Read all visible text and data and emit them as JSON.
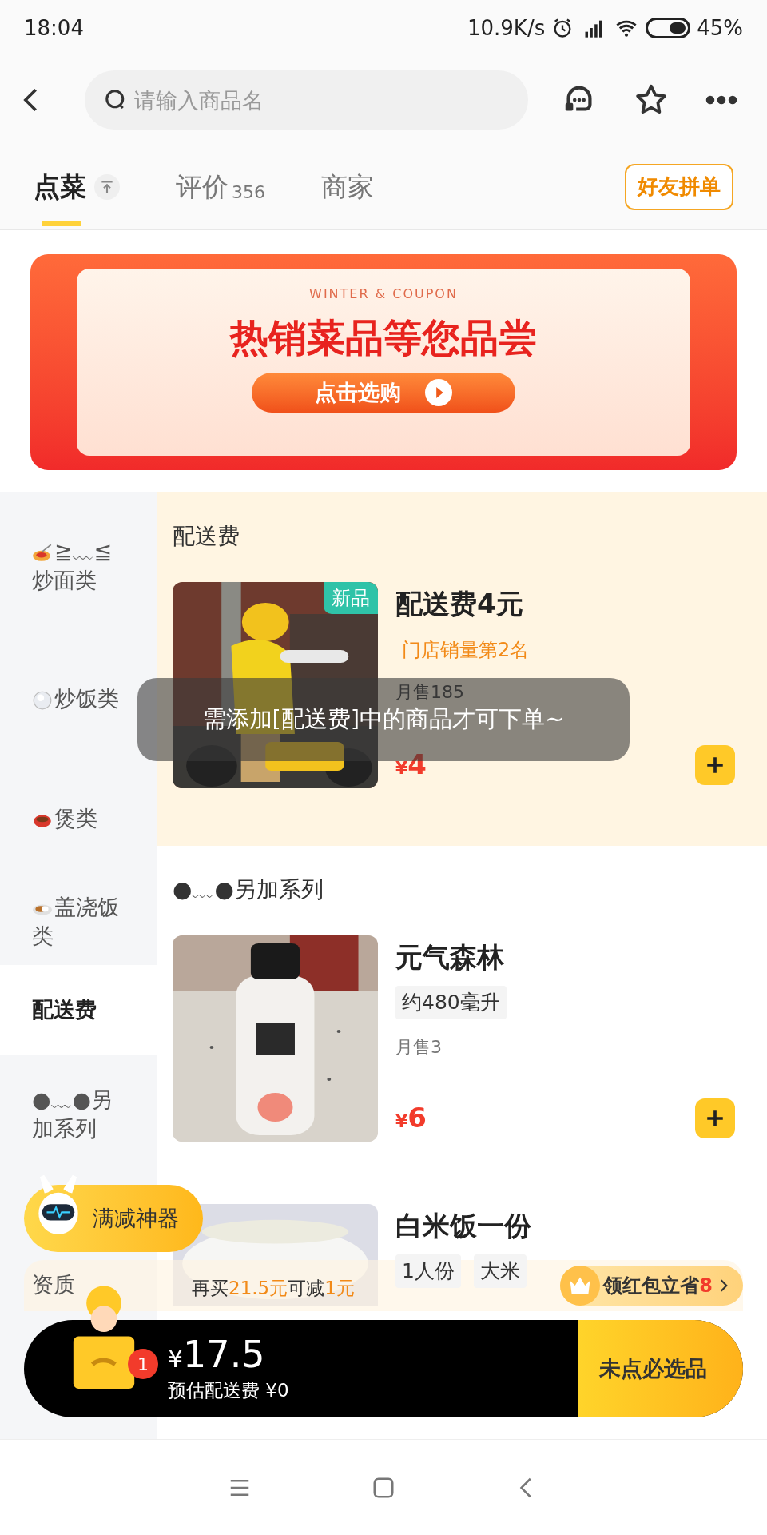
{
  "status_bar": {
    "time": "18:04",
    "net_speed": "10.9K/s",
    "battery": "45%"
  },
  "search": {
    "placeholder": "请输入商品名"
  },
  "tabs": [
    {
      "label": "点菜",
      "selected": true
    },
    {
      "label": "评价",
      "count": "356",
      "selected": false
    },
    {
      "label": "商家",
      "selected": false
    }
  ],
  "group_order_button": "好友拼单",
  "banner": {
    "subtitle": "WINTER & COUPON",
    "title": "热销菜品等您品尝",
    "button": "点击选购"
  },
  "sidebar": {
    "items": [
      {
        "kind": "noodles",
        "label": "≧﹏≦炒面类",
        "selected": false
      },
      {
        "kind": "rice",
        "label": "炒饭类",
        "selected": false
      },
      {
        "kind": "pot",
        "label": "煲类",
        "selected": false
      },
      {
        "kind": "curry",
        "label": "盖浇饭类",
        "selected": false
      },
      {
        "kind": "plain",
        "label": "配送费",
        "selected": true
      },
      {
        "kind": "plain",
        "label": "●﹏●另加系列",
        "selected": false
      },
      {
        "kind": "plain",
        "label": "资质",
        "selected": false
      }
    ]
  },
  "sections": [
    {
      "title": "配送费",
      "highlighted": true,
      "items": [
        {
          "name": "配送费4元",
          "badge": "新品",
          "rank": "门店销量第2名",
          "sales": "月售185",
          "currency": "¥",
          "price": "4"
        }
      ]
    },
    {
      "title": "●﹏●另加系列",
      "highlighted": false,
      "items": [
        {
          "name": "元气森林",
          "tags": [
            "约480毫升"
          ],
          "sales": "月售3",
          "currency": "¥",
          "price": "6"
        },
        {
          "name": "白米饭一份",
          "tags": [
            "1人份",
            "大米"
          ]
        }
      ]
    }
  ],
  "toast": "需添加[配送费]中的商品才可下单~",
  "promo_pill": "满减神器",
  "promo_segments": [
    {
      "text": "再买",
      "highlight": false
    },
    {
      "text": "21.5元",
      "highlight": true
    },
    {
      "text": "可减",
      "highlight": false
    },
    {
      "text": "1元",
      "highlight": true
    }
  ],
  "red_packet": {
    "label": "领红包立省",
    "amount": "8"
  },
  "cart": {
    "count": "1",
    "currency": "¥",
    "total": "17.5",
    "delivery": "预估配送费 ¥0",
    "checkout": "未点必选品"
  }
}
